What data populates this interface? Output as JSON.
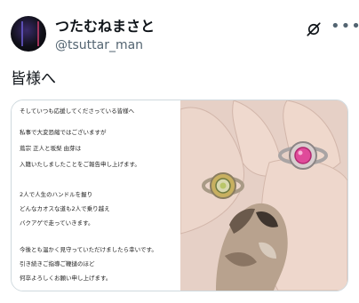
{
  "header": {
    "display_name": "つたむねまさと",
    "handle": "@tsuttar_man"
  },
  "post": {
    "text": "皆様へ"
  },
  "letter": {
    "lines": [
      "そしていつも応援してくださっている皆様へ",
      "私事で大変恐縮ではございますが",
      "蔦宗 正人と坂梨 由芽は",
      "入籍いたしましたことをご報告申し上げます。",
      "2人で人生のハンドルを握り",
      "どんなカオスな道も2人で乗り越え",
      "バクアゲで走っていきます。",
      "今後とも温かく見守っていただけましたら幸いです。",
      "引き続きご指導ご鞭撻のほど",
      "何卒よろしくお願い申し上げます。"
    ]
  },
  "icons": {
    "grok": "grok-icon",
    "more": "more-icon"
  },
  "colors": {
    "text": "#0f1419",
    "secondary": "#536471",
    "border": "#cfd9de",
    "skin": "#e7d2c9",
    "ring_gold": "#c8b060",
    "gem_pink": "#e04a9a"
  }
}
